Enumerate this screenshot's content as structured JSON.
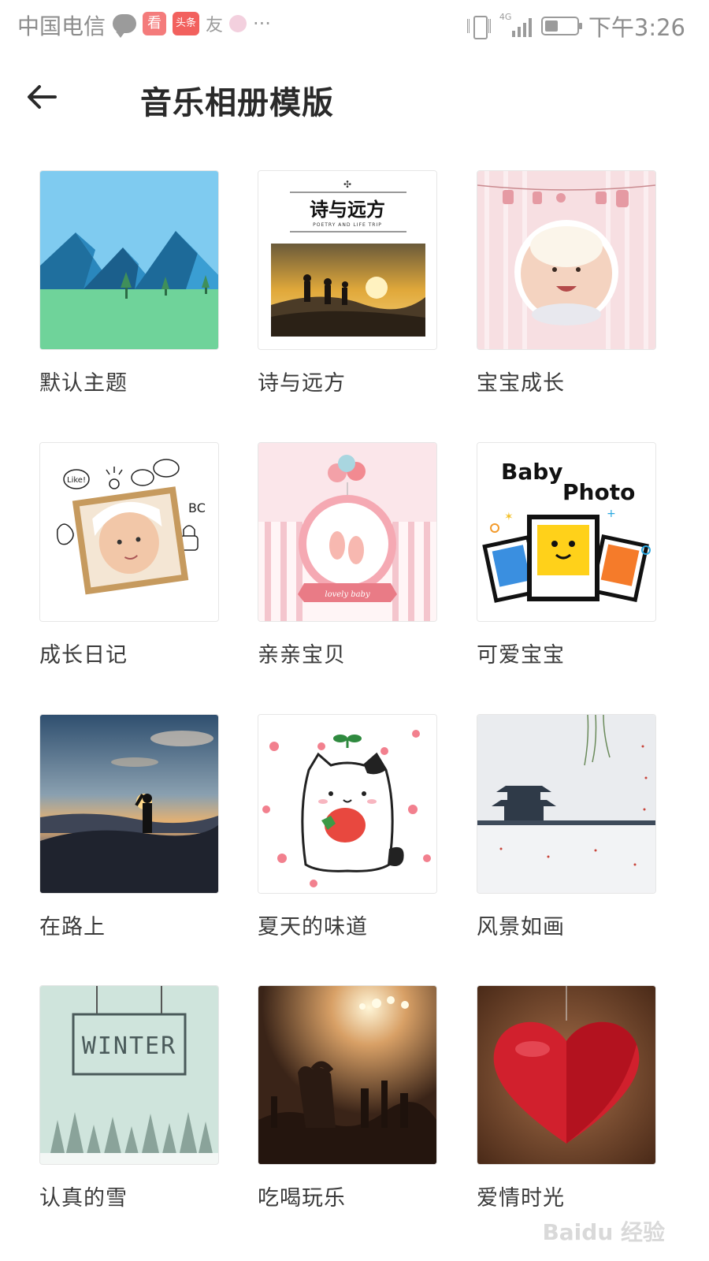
{
  "status_bar": {
    "carrier": "中国电信",
    "app_badge_kan": "看",
    "app_badge_toutiao": "头条",
    "app_badge_you": "友",
    "more": "···",
    "network": "4G",
    "time": "下午3:26"
  },
  "header": {
    "title": "音乐相册模版"
  },
  "templates": [
    {
      "label": "默认主题"
    },
    {
      "label": "诗与远方",
      "thumb_title": "诗与远方",
      "thumb_subtitle": "POETRY AND LIFE TRIP"
    },
    {
      "label": "宝宝成长"
    },
    {
      "label": "成长日记",
      "thumb_doodle": "Like!"
    },
    {
      "label": "亲亲宝贝",
      "thumb_ribbon": "lovely baby"
    },
    {
      "label": "可爱宝宝",
      "thumb_line1": "Baby",
      "thumb_line2": "Photo"
    },
    {
      "label": "在路上"
    },
    {
      "label": "夏天的味道"
    },
    {
      "label": "风景如画"
    },
    {
      "label": "认真的雪",
      "thumb_sign": "WINTER"
    },
    {
      "label": "吃喝玩乐"
    },
    {
      "label": "爱情时光"
    }
  ],
  "watermark": "Baidu 经验"
}
